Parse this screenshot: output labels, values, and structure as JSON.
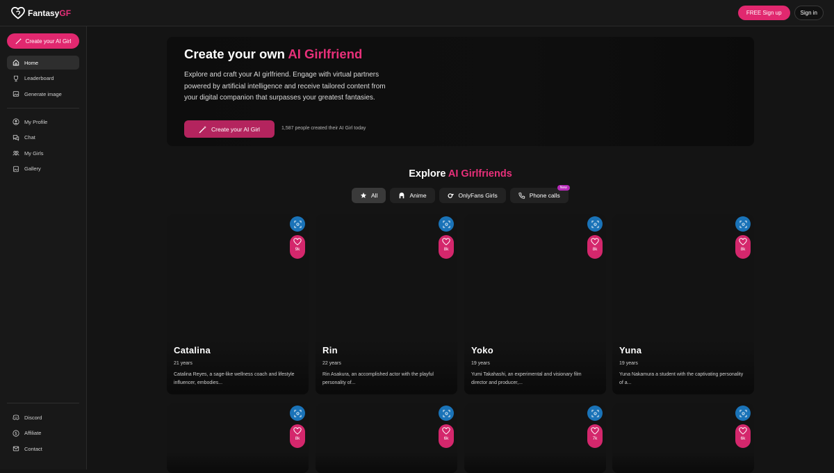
{
  "brand": {
    "name_white": "Fantasy",
    "name_pink": "GF"
  },
  "topbar": {
    "signup_label": "FREE Sign up",
    "signin_label": "Sign in"
  },
  "sidebar": {
    "create_label": "Create your AI Girl",
    "primary": [
      {
        "label": "Home",
        "icon": "home-icon"
      },
      {
        "label": "Leaderboard",
        "icon": "trophy-icon"
      },
      {
        "label": "Generate image",
        "icon": "image-icon"
      }
    ],
    "secondary": [
      {
        "label": "My Profile",
        "icon": "user-icon"
      },
      {
        "label": "Chat",
        "icon": "chat-icon"
      },
      {
        "label": "My Girls",
        "icon": "users-icon"
      },
      {
        "label": "Gallery",
        "icon": "gallery-icon"
      }
    ],
    "footer": [
      {
        "label": "Discord",
        "icon": "discord-icon"
      },
      {
        "label": "Affiliate",
        "icon": "dollar-icon"
      },
      {
        "label": "Contact",
        "icon": "mail-icon"
      }
    ]
  },
  "hero": {
    "title_white": "Create your own ",
    "title_pink": "AI Girlfriend",
    "description": "Explore and craft your AI girlfriend. Engage with virtual partners powered by artificial intelligence and receive tailored content from your digital companion that surpasses your greatest fantasies.",
    "button_label": "Create your AI Girl",
    "note": "1,587 people created their AI Girl today"
  },
  "explore": {
    "title_white": "Explore ",
    "title_pink": "AI Girlfriends",
    "filters": [
      {
        "label": "All",
        "active": true
      },
      {
        "label": "Anime"
      },
      {
        "label": "OnlyFans Girls"
      },
      {
        "label": "Phone calls",
        "badge": "New"
      }
    ]
  },
  "cards": [
    {
      "name": "Catalina",
      "age": "21 years",
      "desc": "Catalina Reyes, a sage-like wellness coach and lifestyle influencer, embodies...",
      "likes": "9k"
    },
    {
      "name": "Rin",
      "age": "22 years",
      "desc": "Rin Asakura, an accomplished actor with the playful personality of...",
      "likes": "8k"
    },
    {
      "name": "Yoko",
      "age": "19 years",
      "desc": "Yumi Takahashi, an experimental and visionary film director and producer,...",
      "likes": "8k"
    },
    {
      "name": "Yuna",
      "age": "19 years",
      "desc": "Yuna Nakamura a student with the captivating personality of a...",
      "likes": "8k"
    },
    {
      "likes": "8k"
    },
    {
      "likes": "6k"
    },
    {
      "likes": "7k"
    },
    {
      "likes": "6k"
    }
  ],
  "colors": {
    "accent": "#e1286f",
    "scan": "#1a73b8",
    "new_badge": "#b62ab8"
  }
}
